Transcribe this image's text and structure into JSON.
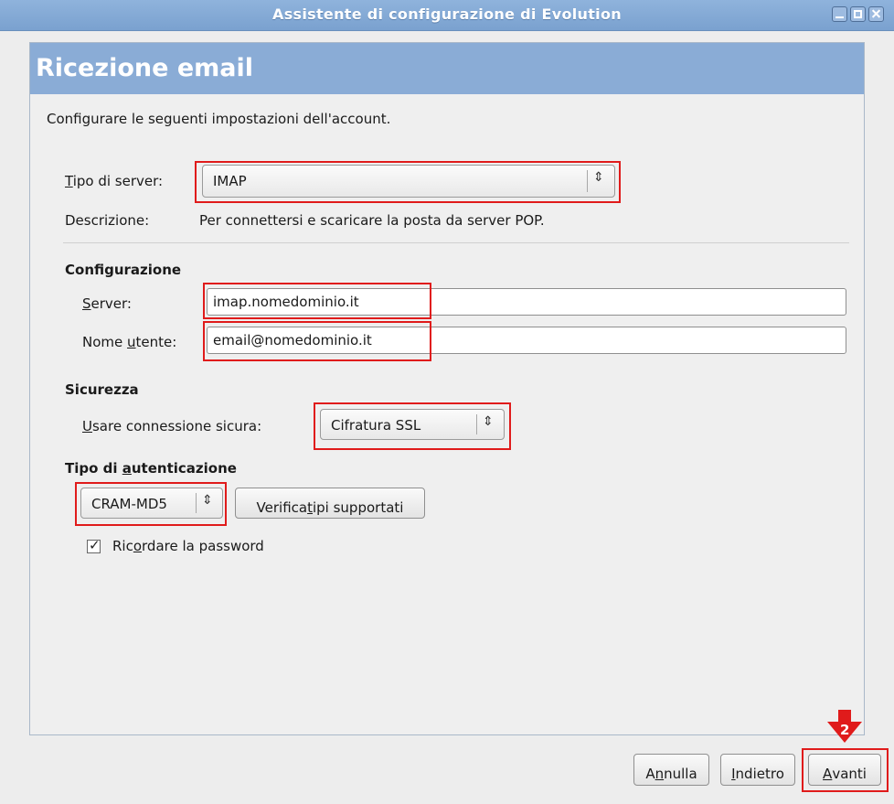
{
  "window": {
    "title": "Assistente di configurazione di Evolution"
  },
  "page": {
    "title": "Ricezione email",
    "intro": "Configurare le seguenti impostazioni dell'account."
  },
  "server_type": {
    "label_u": "T",
    "label_rest": "ipo di server:",
    "value": "IMAP"
  },
  "description": {
    "label": "Descrizione:",
    "text": "Per connettersi e scaricare la posta da server POP."
  },
  "config": {
    "heading": "Configurazione",
    "server_label_u": "S",
    "server_label_rest": "erver:",
    "server_value": "imap.nomedominio.it",
    "user_label_pre": "Nome ",
    "user_label_u": "u",
    "user_label_rest": "tente:",
    "user_value": "email@nomedominio.it"
  },
  "security": {
    "heading": "Sicurezza",
    "label_u": "U",
    "label_rest": "sare connessione sicura:",
    "value": "Cifratura SSL"
  },
  "auth": {
    "heading_pre": "Tipo di ",
    "heading_u": "a",
    "heading_rest": "utenticazione",
    "value": "CRAM-MD5",
    "check_btn_pre": "Verifica ",
    "check_btn_u": "t",
    "check_btn_rest": "ipi supportati",
    "remember_pre": "Ric",
    "remember_u": "o",
    "remember_rest": "rdare la password",
    "remember_checked": true
  },
  "buttons": {
    "cancel_pre": "A",
    "cancel_u": "n",
    "cancel_rest": "nulla",
    "back_u": "I",
    "back_rest": "ndietro",
    "next_u": "A",
    "next_rest": "vanti"
  },
  "annotation": {
    "step": "2",
    "color": "#e01b1b"
  },
  "colors": {
    "header": "#8aacd6",
    "titlebar": "#7aa1cf",
    "highlight": "#e01b1b"
  }
}
